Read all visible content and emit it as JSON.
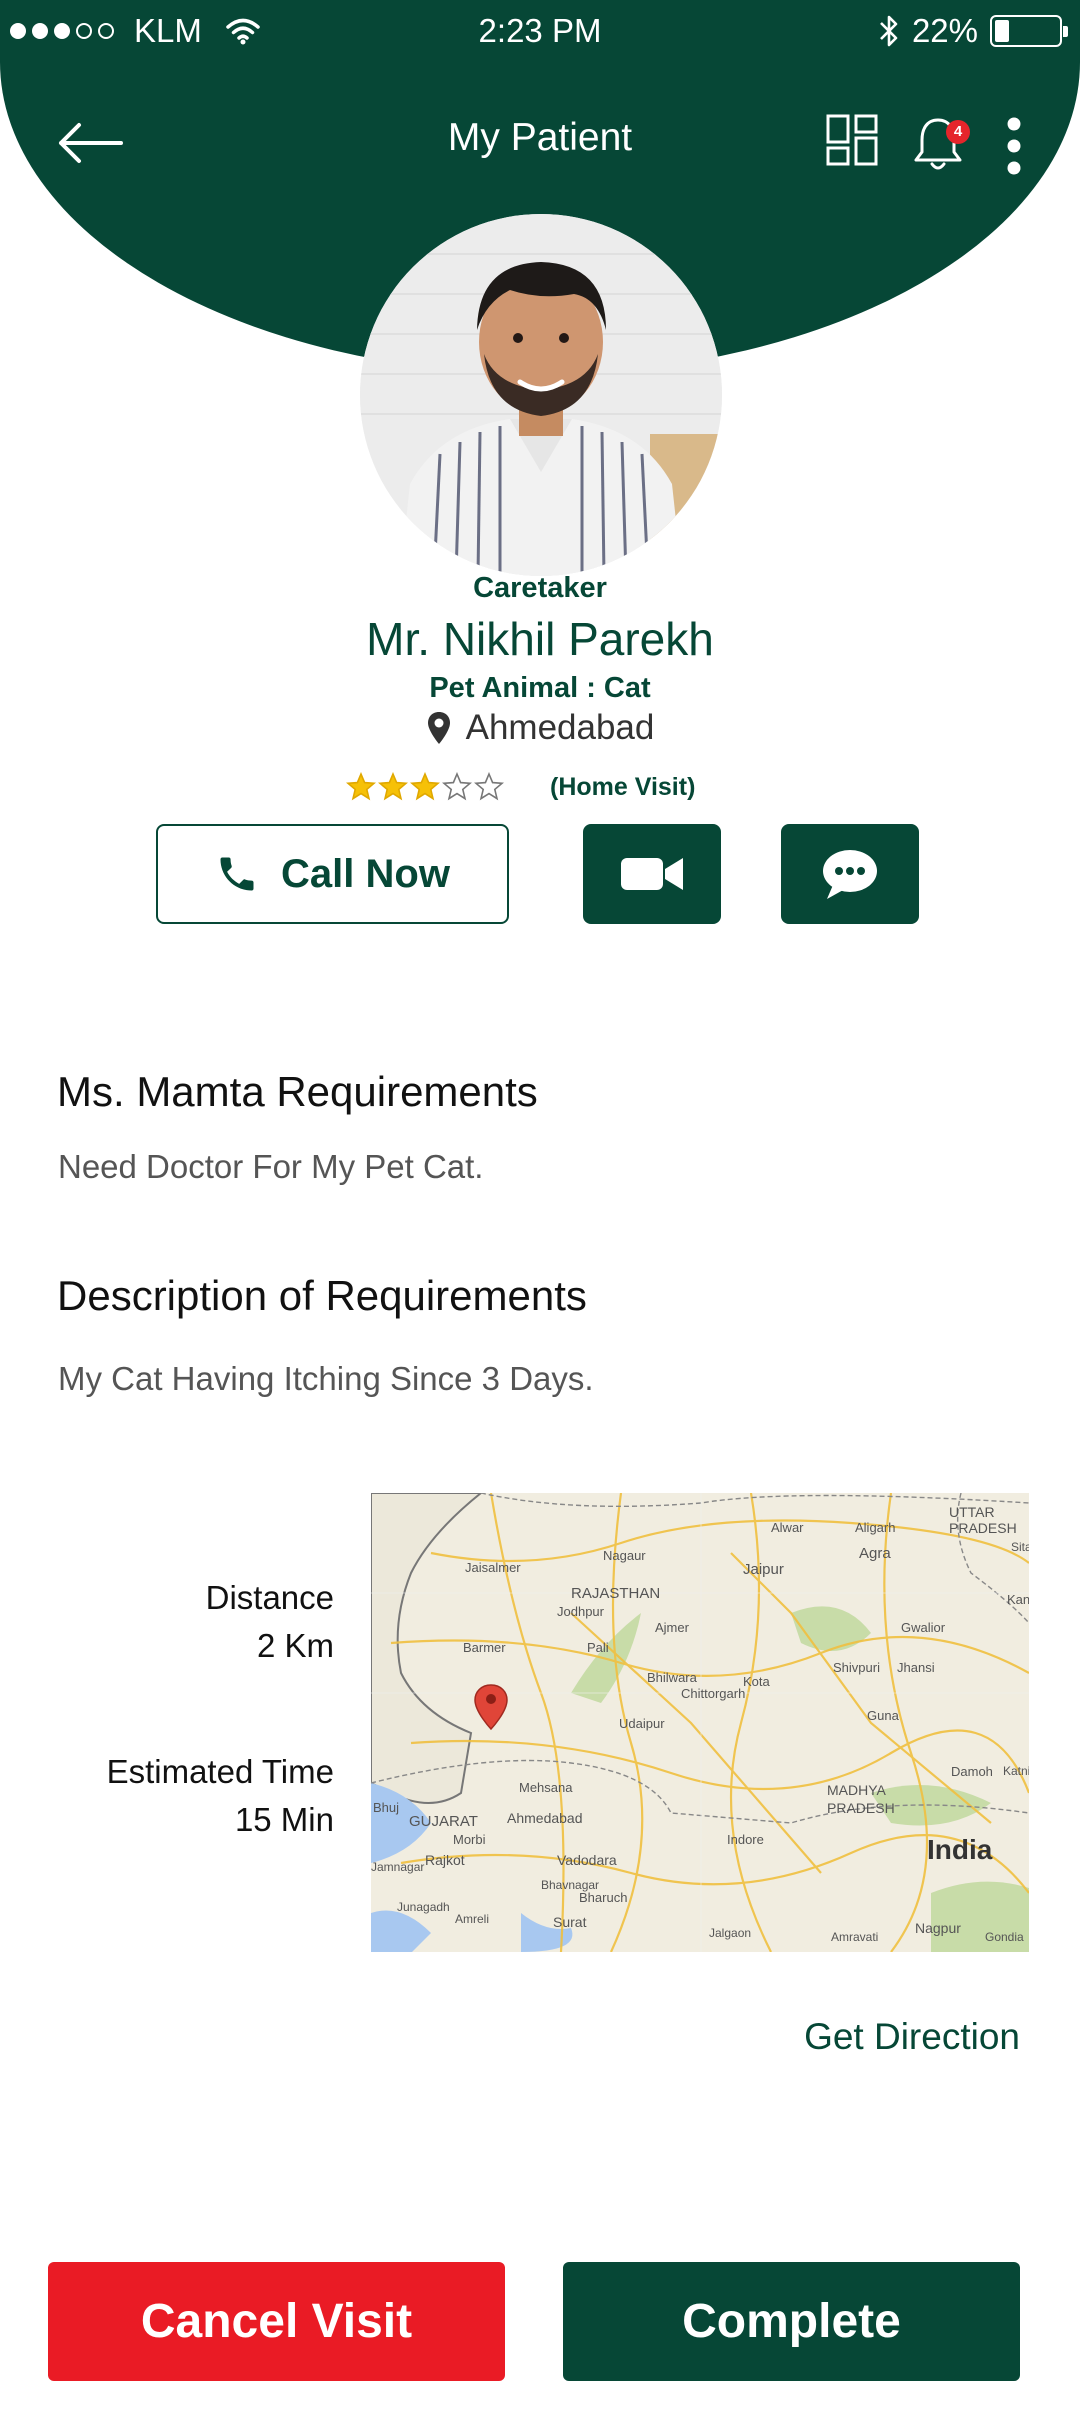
{
  "status_bar": {
    "carrier": "KLM",
    "time": "2:23 PM",
    "battery_text": "22%",
    "battery_level": 0.22,
    "signal_bars": 3,
    "signal_total": 5
  },
  "header": {
    "title": "My Patient",
    "notification_count": "4",
    "color": "#064736"
  },
  "profile": {
    "role": "Caretaker",
    "name": "Mr. Nikhil Parekh",
    "pet": "Pet Animal : Cat",
    "city": "Ahmedabad",
    "rating": 3,
    "rating_max": 5,
    "visit_type": "(Home Visit)"
  },
  "actions": {
    "call_label": "Call Now"
  },
  "requirements": {
    "title": "Ms. Mamta Requirements",
    "text": "Need Doctor For My Pet Cat."
  },
  "description": {
    "title": "Description of Requirements",
    "text": "My Cat Having Itching Since 3 Days."
  },
  "trip": {
    "distance_label": "Distance",
    "distance_value": "2 Km",
    "time_label": "Estimated Time",
    "time_value": "15 Min",
    "direction_label": "Get Direction"
  },
  "map": {
    "labels": [
      "UTTAR",
      "PRADESH",
      "Alwar",
      "Aligarh",
      "Sita",
      "Agra",
      "Jaisalmer",
      "Nagaur",
      "Jaipur",
      "Kanpur",
      "RAJASTHAN",
      "Jodhpur",
      "Ajmer",
      "Gwalior",
      "Barmer",
      "Pali",
      "Shivpuri",
      "Jhansi",
      "Bhilwara",
      "Kota",
      "Chittorgarh",
      "Udaipur",
      "Guna",
      "Damoh",
      "Katni",
      "Mehsana",
      "MADHYA",
      "PRADESH",
      "Bhuj",
      "GUJARAT",
      "Ahmedabad",
      "Morbi",
      "Rajkot",
      "Vadodara",
      "Indore",
      "India",
      "Jamnagar",
      "Bhavnagar",
      "Bharuch",
      "Junagadh",
      "Amreli",
      "Surat",
      "Jalgaon",
      "Amravati",
      "Nagpur",
      "Gondia"
    ]
  },
  "footer": {
    "cancel_label": "Cancel Visit",
    "complete_label": "Complete",
    "cancel_color": "#ea1b25",
    "complete_color": "#064736"
  }
}
